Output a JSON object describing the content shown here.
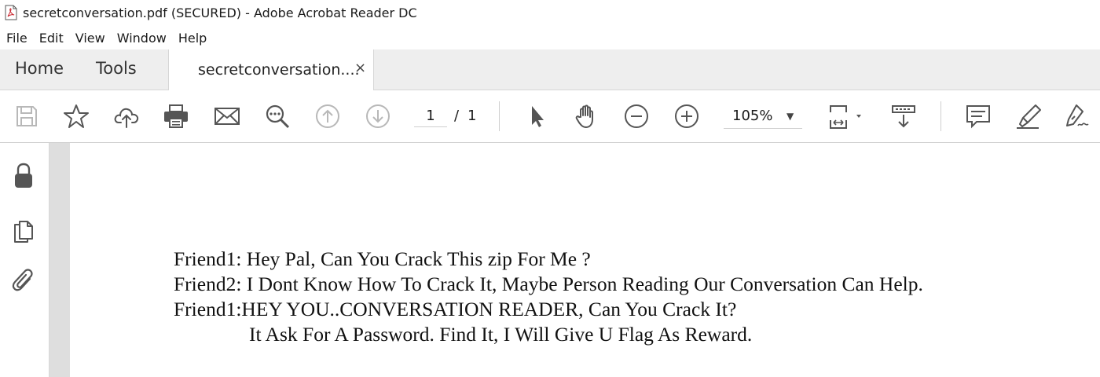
{
  "window": {
    "title": "secretconversation.pdf (SECURED) - Adobe Acrobat Reader DC",
    "app_icon": "pdf-file-icon"
  },
  "menu": [
    "File",
    "Edit",
    "View",
    "Window",
    "Help"
  ],
  "tabs": {
    "home": "Home",
    "tools": "Tools",
    "document": "secretconversation....",
    "close": "×"
  },
  "toolbar": {
    "icons": [
      "save-icon",
      "bookmark-star-icon",
      "cloud-upload-icon",
      "print-icon",
      "email-icon",
      "find-icon",
      "prev-page-icon",
      "next-page-icon",
      "select-cursor-icon",
      "hand-icon",
      "zoom-out-icon",
      "zoom-in-icon",
      "fit-page-icon",
      "scroll-mode-icon",
      "comment-icon",
      "highlight-icon",
      "sign-icon"
    ],
    "page_current": "1",
    "page_separator": "/",
    "page_total": "1",
    "zoom": "105%"
  },
  "left_panel": {
    "icons": [
      "lock-icon",
      "pages-icon",
      "attachment-icon"
    ]
  },
  "document": {
    "lines": [
      "Friend1: Hey Pal, Can You Crack This zip For Me ?",
      "Friend2: I Dont Know How To Crack It, Maybe Person Reading Our Conversation Can Help.",
      "Friend1:HEY YOU..CONVERSATION READER, Can You Crack It?",
      "It Ask For A Password. Find It, I Will Give U Flag As Reward."
    ]
  },
  "colors": {
    "tabbar_bg": "#eeeeee",
    "icon_gray": "#5a5a5a",
    "disabled_gray": "#b8b8b8",
    "gutter": "#dedede"
  }
}
